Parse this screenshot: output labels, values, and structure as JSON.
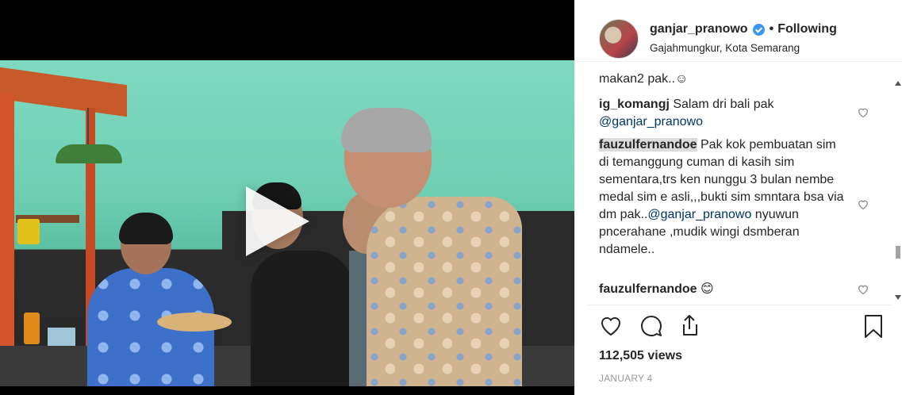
{
  "post": {
    "username": "ganjar_pranowo",
    "separator": "•",
    "follow_status": "Following",
    "location": "Gajahmungkur, Kota Semarang",
    "views": "112,505 views",
    "date": "JANUARY 4"
  },
  "comments": [
    {
      "text": "makan2 pak..☺"
    },
    {
      "user": "ig_komangj",
      "text": " Salam dri bali pak ",
      "mention": "@ganjar_pranowo",
      "after": ""
    },
    {
      "user": "fauzulfernandoe",
      "text": " Pak kok pembuatan sim di temanggung cuman di kasih sim sementara,trs ken nunggu 3 bulan nembe medal sim e asli,,,bukti sim smntara bsa via dm pak..",
      "mention": "@ganjar_pranowo",
      "after": " nyuwun pncerahane ,mudik wingi dsmberan ndamele.."
    },
    {
      "user": "fauzulfernandoe",
      "text": " 😊"
    }
  ],
  "icons": {
    "play": "play-icon",
    "verified": "verified-badge-icon",
    "like": "heart-icon",
    "comment": "comment-icon",
    "share": "share-icon",
    "save": "bookmark-icon"
  },
  "colors": {
    "verified": "#3897f0",
    "mention": "#003569",
    "date": "#999999",
    "highlight": "#dcdcdc"
  }
}
